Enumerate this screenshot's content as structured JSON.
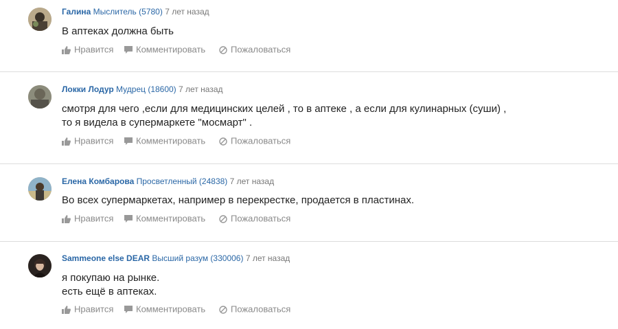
{
  "actions": {
    "like": "Нравится",
    "comment": "Комментировать",
    "report": "Пожаловаться"
  },
  "answers": [
    {
      "author": "Галина",
      "rank": "Мыслитель (5780)",
      "time": "7 лет назад",
      "lines": [
        "В аптеках должна быть"
      ]
    },
    {
      "author": "Локки Лодур",
      "rank": "Мудрец (18600)",
      "time": "7 лет назад",
      "lines": [
        "смотря для чего ,если для медицинских целей , то в аптеке , а если для кулинарных (суши) ,",
        "то я видела в супермаркете \"мосмарт\" ."
      ]
    },
    {
      "author": "Елена Комбарова",
      "rank": "Просветленный (24838)",
      "time": "7 лет назад",
      "lines": [
        "Во всех супермаркетах, например в перекрестке, продается в пластинах."
      ]
    },
    {
      "author": "Sammeone else DEAR",
      "rank": "Высший разум (330006)",
      "time": "7 лет назад",
      "lines": [
        "я покупаю на рынке.",
        "есть ещё в аптеках."
      ]
    }
  ],
  "colors": {
    "link": "#2a67a6",
    "muted": "#8a8a8a",
    "separator": "#dcdcdc"
  }
}
